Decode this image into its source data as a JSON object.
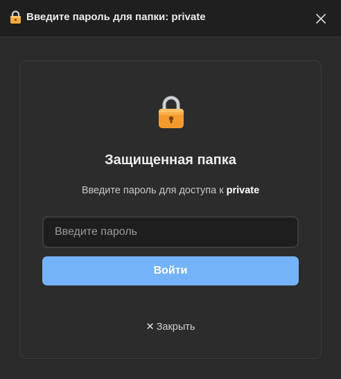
{
  "window": {
    "title_icon": "lock-icon",
    "title": "Введите пароль для папки: private",
    "close_icon": "close-icon"
  },
  "card": {
    "icon": "lock-icon",
    "heading": "Защищенная папка",
    "subtitle_prefix": "Введите пароль для доступа к",
    "folder_name": "private",
    "password": {
      "value": "",
      "placeholder": "Введите пароль"
    },
    "login_label": "Войти",
    "close_glyph": "✕",
    "close_label": "Закрыть"
  },
  "colors": {
    "background": "#2a2a2a",
    "titlebar": "#1f1f1f",
    "accent_button": "#74b3f9",
    "lock_body": "#f7a63a",
    "lock_shackle": "#b9bcc4"
  }
}
